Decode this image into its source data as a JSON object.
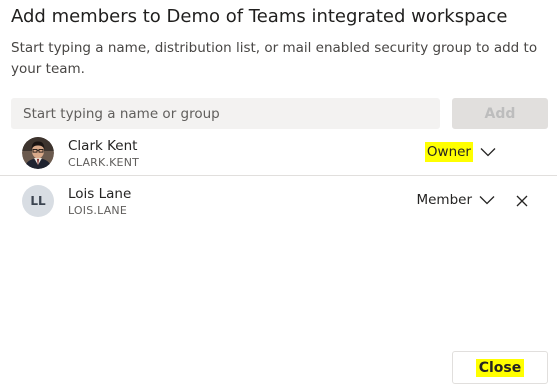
{
  "dialog": {
    "title": "Add members to Demo of Teams integrated workspace",
    "description": "Start typing a name, distribution list, or mail enabled security group to add to your team.",
    "search": {
      "placeholder": "Start typing a name or group",
      "value": ""
    },
    "add_label": "Add",
    "close_label": "Close"
  },
  "members": [
    {
      "name": "Clark Kent",
      "id": "CLARK.KENT",
      "role": "Owner",
      "avatar": "photo",
      "removable": false
    },
    {
      "name": "Lois Lane",
      "id": "LOIS.LANE",
      "role": "Member",
      "avatar_initials": "LL",
      "removable": true
    }
  ],
  "icons": {
    "role_dropdown": "chevron-down-icon",
    "remove": "close-icon"
  },
  "colors": {
    "highlight": "#ffff00",
    "search_bg": "#f3f2f1",
    "disabled_button_bg": "#e1dfdd",
    "divider": "#e1dfdd"
  }
}
